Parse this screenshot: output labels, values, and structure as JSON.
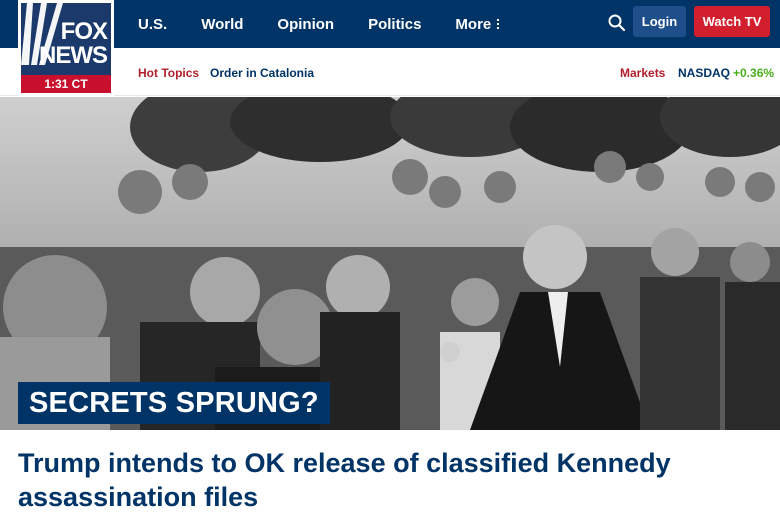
{
  "logo": {
    "line1": "FOX",
    "line2": "NEWS",
    "time": "1:31 CT"
  },
  "nav": {
    "items": [
      "U.S.",
      "World",
      "Opinion",
      "Politics"
    ],
    "more_label": "More"
  },
  "header_actions": {
    "search_icon": "search-icon",
    "login_label": "Login",
    "watch_label": "Watch TV"
  },
  "subnav": {
    "hot_topics": "Hot Topics",
    "link": "Order in Catalonia",
    "markets": "Markets",
    "index_name": "NASDAQ",
    "index_change": "+0.36%"
  },
  "hero": {
    "kicker": "SECRETS SPRUNG?"
  },
  "article": {
    "headline": "Trump intends to OK release of classified Kennedy assassination files"
  },
  "colors": {
    "nav_bg": "#003366",
    "accent_red": "#d11f2d",
    "positive": "#4caf1e"
  }
}
